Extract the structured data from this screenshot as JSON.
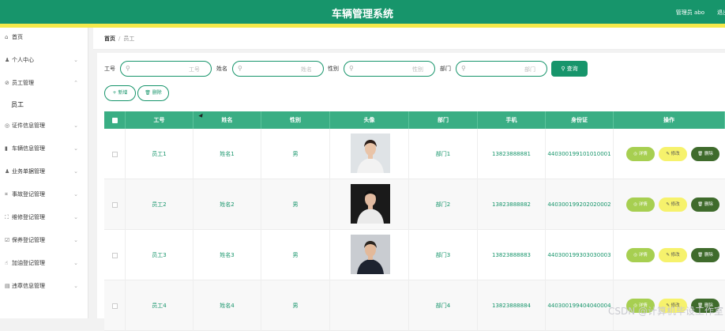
{
  "header": {
    "title": "车辆管理系统",
    "user": "管理员 abo",
    "logout": "退出"
  },
  "sidebar": {
    "items": [
      {
        "label": "首页",
        "icon": "home-icon",
        "glyph": "⌂",
        "chevron": ""
      },
      {
        "label": "个人中心",
        "icon": "user-icon",
        "glyph": "♟",
        "chevron": "⌄"
      },
      {
        "label": "员工管理",
        "icon": "staff-icon",
        "glyph": "⊘",
        "chevron": "⌃"
      },
      {
        "label": "证件信息管理",
        "icon": "id-card-icon",
        "glyph": "◎",
        "chevron": "⌄"
      },
      {
        "label": "车辆信息管理",
        "icon": "car-icon",
        "glyph": "▮",
        "chevron": "⌄"
      },
      {
        "label": "业务单据管理",
        "icon": "people-icon",
        "glyph": "♟",
        "chevron": "⌄"
      },
      {
        "label": "事故登记管理",
        "icon": "crop-icon",
        "glyph": "⌗",
        "chevron": "⌄"
      },
      {
        "label": "维修登记管理",
        "icon": "frame-icon",
        "glyph": "⛶",
        "chevron": "⌄"
      },
      {
        "label": "保养登记管理",
        "icon": "check-icon",
        "glyph": "☑",
        "chevron": "⌄"
      },
      {
        "label": "加油登记管理",
        "icon": "thumb-icon",
        "glyph": "☝",
        "chevron": "⌄"
      },
      {
        "label": "违章信息管理",
        "icon": "doc-icon",
        "glyph": "▤",
        "chevron": "⌄"
      }
    ],
    "sub_item": "员工"
  },
  "breadcrumb": {
    "home": "首页",
    "sep": "/",
    "current": "员工"
  },
  "search": {
    "fields": [
      {
        "label": "工号",
        "placeholder": "工号"
      },
      {
        "label": "姓名",
        "placeholder": "姓名"
      },
      {
        "label": "性别",
        "placeholder": "性别"
      },
      {
        "label": "部门",
        "placeholder": "部门"
      }
    ],
    "query_label": "查询",
    "add_label": "新增",
    "delete_label": "删除"
  },
  "table": {
    "columns": [
      "工号",
      "姓名",
      "性别",
      "头像",
      "部门",
      "手机",
      "身份证",
      "操作"
    ],
    "ops": {
      "detail": "详情",
      "edit": "修改",
      "delete": "删除"
    },
    "rows": [
      {
        "id": "员工1",
        "name": "姓名1",
        "gender": "男",
        "dept": "部门1",
        "phone": "13823888881",
        "idcard": "440300199101010001"
      },
      {
        "id": "员工2",
        "name": "姓名2",
        "gender": "男",
        "dept": "部门2",
        "phone": "13823888882",
        "idcard": "440300199202020002"
      },
      {
        "id": "员工3",
        "name": "姓名3",
        "gender": "男",
        "dept": "部门3",
        "phone": "13823888883",
        "idcard": "440300199303030003"
      },
      {
        "id": "员工4",
        "name": "姓名4",
        "gender": "男",
        "dept": "部门4",
        "phone": "13823888884",
        "idcard": "440300199404040004"
      }
    ]
  },
  "watermark": "CSDN @计算机毕设工作室",
  "colors": {
    "primary": "#17956b",
    "accent_yellow": "#f5e94a",
    "table_head": "#3aae84"
  }
}
